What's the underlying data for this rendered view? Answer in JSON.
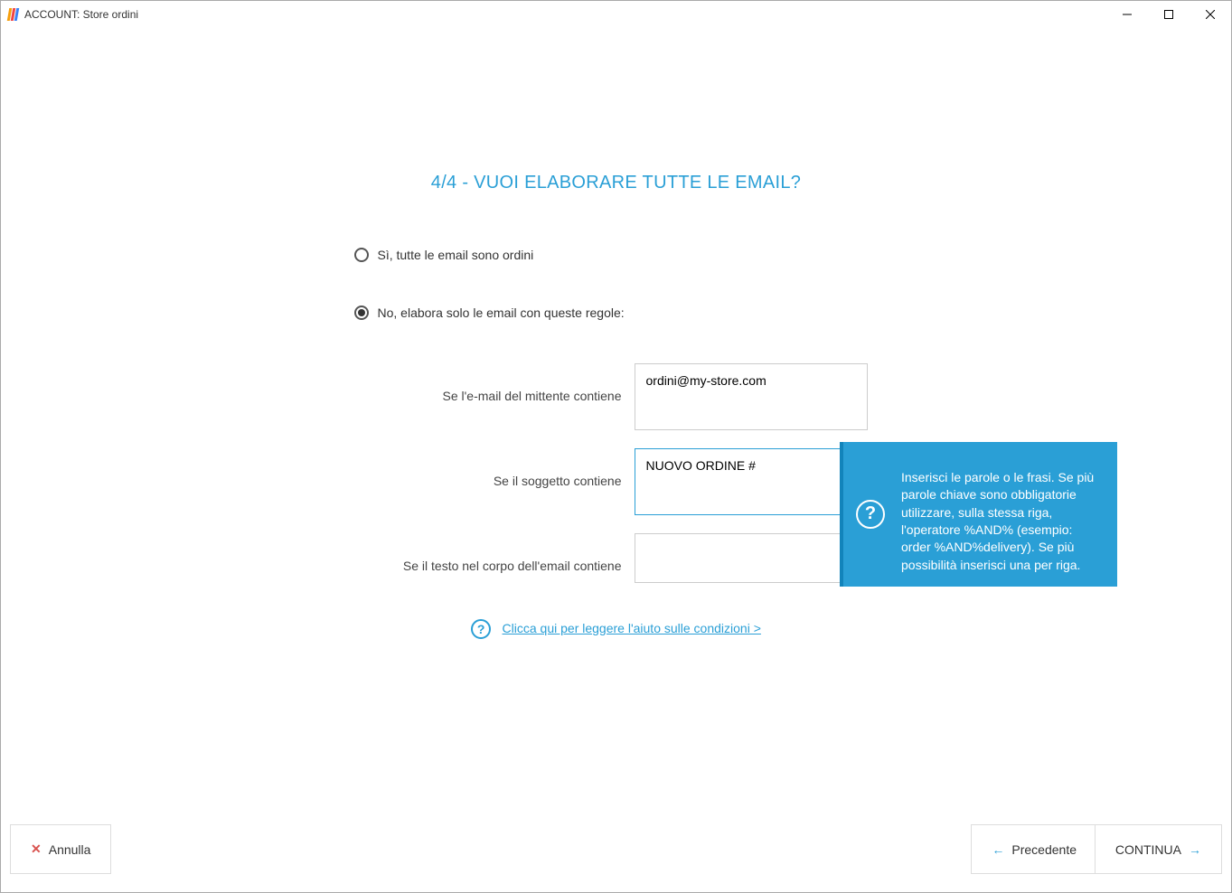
{
  "window": {
    "title": "ACCOUNT: Store ordini"
  },
  "heading": "4/4 - VUOI ELABORARE TUTTE LE EMAIL?",
  "radios": {
    "yes": "Sì, tutte le email sono ordini",
    "no": "No, elabora solo le email con queste regole:"
  },
  "fields": {
    "sender_label": "Se l'e-mail del mittente contiene",
    "sender_value": "ordini@my-store.com",
    "subject_label": "Se il soggetto contiene",
    "subject_value": "NUOVO ORDINE #",
    "body_label": "Se il testo nel corpo dell'email contiene",
    "body_value": ""
  },
  "tooltip": "Inserisci le parole o le frasi. Se più parole chiave sono obbligatorie utilizzare, sulla stessa riga, l'operatore %AND% (esempio: order %AND%delivery). Se più possibilità inserisci una per riga.",
  "help_link": "Clicca qui per leggere l'aiuto sulle condizioni >",
  "buttons": {
    "cancel": "Annulla",
    "prev": "Precedente",
    "next": "CONTINUA"
  }
}
